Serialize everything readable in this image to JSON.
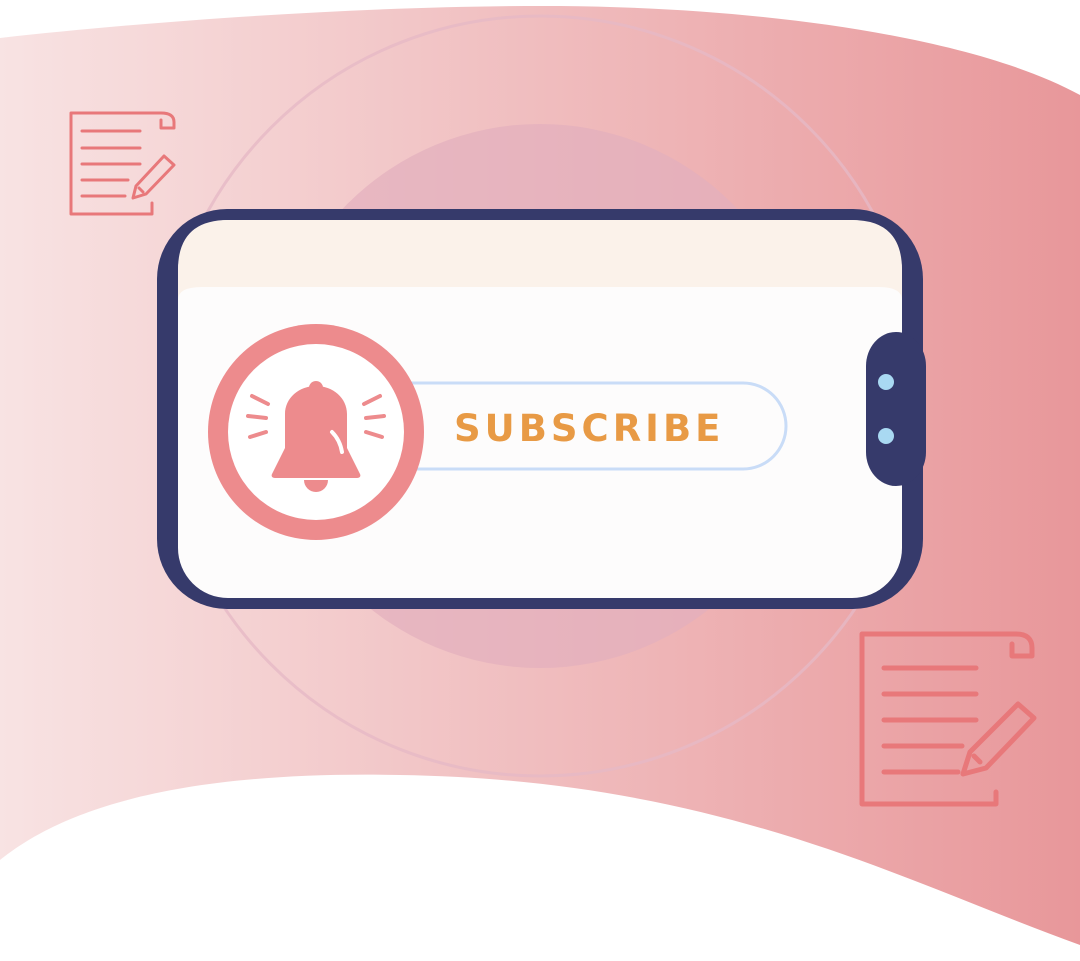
{
  "subscribe": {
    "label": "SUBSCRIBE"
  },
  "icons": {
    "bell": "bell-icon",
    "document_top": "document-edit-icon",
    "document_bottom": "document-edit-icon"
  },
  "colors": {
    "background_gradient": [
      "#f8e3e3",
      "#e8979a"
    ],
    "phone_frame": "#363a6b",
    "screen_top_bar": "#fbf2ea",
    "screen": "#fdfcfc",
    "bell_accent": "#ed8b8d",
    "button_outline": "#c9dcf7",
    "subscribe_text": "#e89a45",
    "side_dots": "#a9d9f2",
    "halo": "#e0b2c0"
  }
}
